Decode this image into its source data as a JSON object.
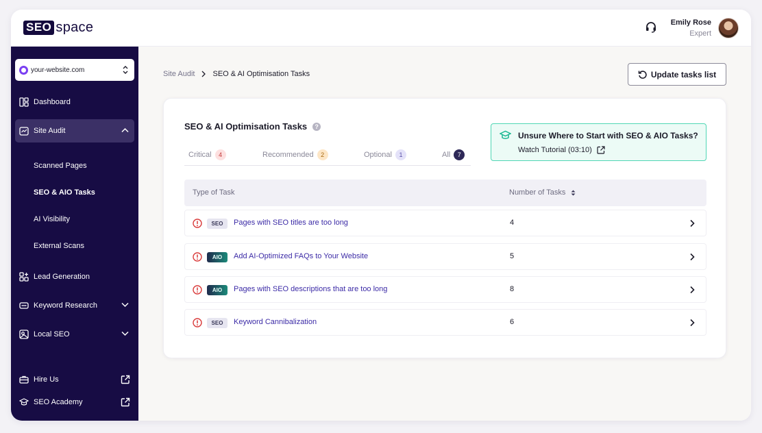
{
  "brand": {
    "logo_box": "SEO",
    "logo_text": "space"
  },
  "user": {
    "name": "Emily Rose",
    "role": "Expert"
  },
  "site_selector": {
    "value": "your-website.com"
  },
  "sidebar": {
    "items": [
      {
        "label": "Dashboard"
      },
      {
        "label": "Site Audit"
      },
      {
        "label": "Lead Generation"
      },
      {
        "label": "Keyword Research"
      },
      {
        "label": "Local SEO"
      },
      {
        "label": "Hire Us"
      },
      {
        "label": "SEO Academy"
      }
    ],
    "sub_items": [
      {
        "label": "Scanned Pages"
      },
      {
        "label": "SEO & AIO Tasks"
      },
      {
        "label": "AI Visibility"
      },
      {
        "label": "External Scans"
      }
    ]
  },
  "breadcrumb": {
    "parent": "Site Audit",
    "current": "SEO & AI Optimisation Tasks"
  },
  "update_button": {
    "label": "Update tasks list"
  },
  "card": {
    "title": "SEO & AI Optimisation Tasks",
    "help": "?",
    "tabs": [
      {
        "label": "Critical",
        "count": "4"
      },
      {
        "label": "Recommended",
        "count": "2"
      },
      {
        "label": "Optional",
        "count": "1"
      },
      {
        "label": "All",
        "count": "7"
      }
    ],
    "promo": {
      "title": "Unsure Where to Start with SEO & AIO Tasks?",
      "link": "Watch Tutorial (03:10)"
    },
    "table": {
      "col_type": "Type of Task",
      "col_count": "Number of Tasks",
      "rows": [
        {
          "tag": "SEO",
          "title": "Pages with SEO titles are too long",
          "count": "4"
        },
        {
          "tag": "AIO",
          "title": "Add AI-Optimized FAQs to Your Website",
          "count": "5"
        },
        {
          "tag": "AIO",
          "title": "Pages with SEO descriptions that are too long",
          "count": "8"
        },
        {
          "tag": "SEO",
          "title": "Keyword Cannibalization",
          "count": "6"
        }
      ]
    }
  },
  "colors": {
    "sidebar": "#170c44",
    "accent_link": "#3b2aa6",
    "promo_border": "#4fd6b4",
    "critical": "#d93b3b"
  }
}
